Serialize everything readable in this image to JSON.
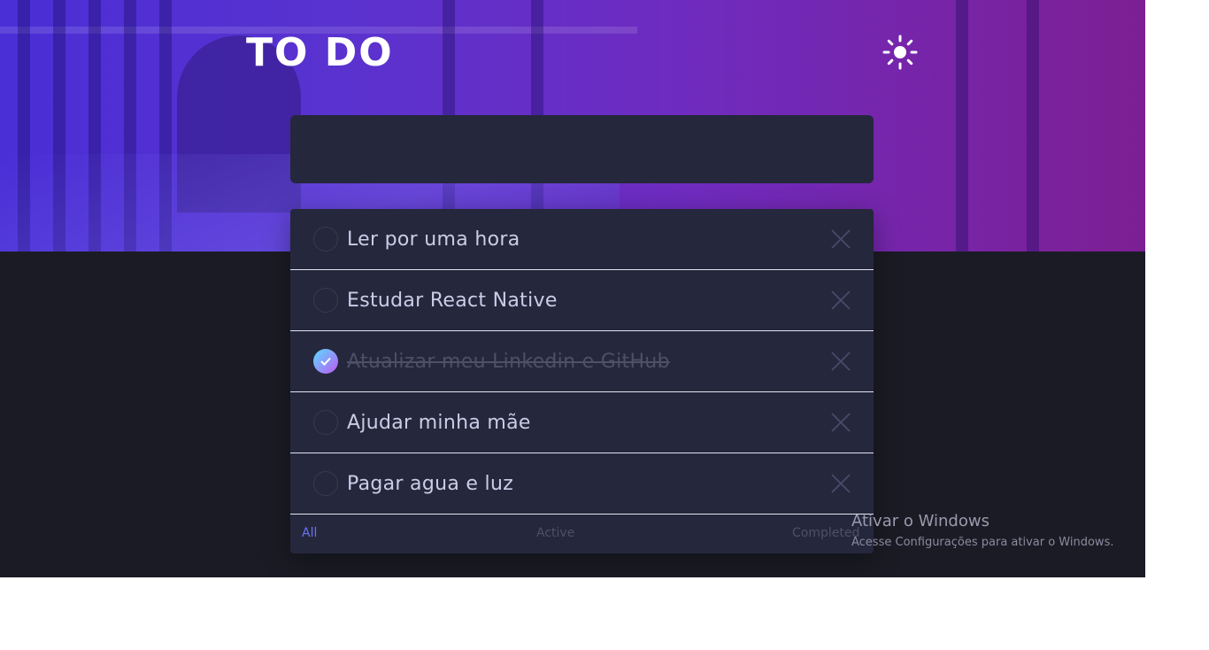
{
  "app": {
    "title": "TO DO",
    "theme_icon": "sun-icon"
  },
  "new_todo": {
    "value": ""
  },
  "todos": [
    {
      "text": "Ler por uma hora",
      "completed": false
    },
    {
      "text": "Estudar React Native",
      "completed": false
    },
    {
      "text": "Atualizar meu Linkedin e GitHub",
      "completed": true
    },
    {
      "text": "Ajudar minha mãe",
      "completed": false
    },
    {
      "text": "Pagar agua e luz",
      "completed": false
    }
  ],
  "filters": {
    "all": "All",
    "active": "Active",
    "completed": "Completed",
    "selected": "all"
  },
  "windows_watermark": {
    "title": "Ativar o Windows",
    "subtitle": "Acesse Configurações para ativar o Windows."
  },
  "colors": {
    "hero_gradient_start": "#4a2ed6",
    "hero_gradient_end": "#7d1f93",
    "background": "#1b1b25",
    "card": "#25273c",
    "accent": "#6a73f5",
    "check_gradient_start": "#57ddff",
    "check_gradient_end": "#c058f3"
  }
}
